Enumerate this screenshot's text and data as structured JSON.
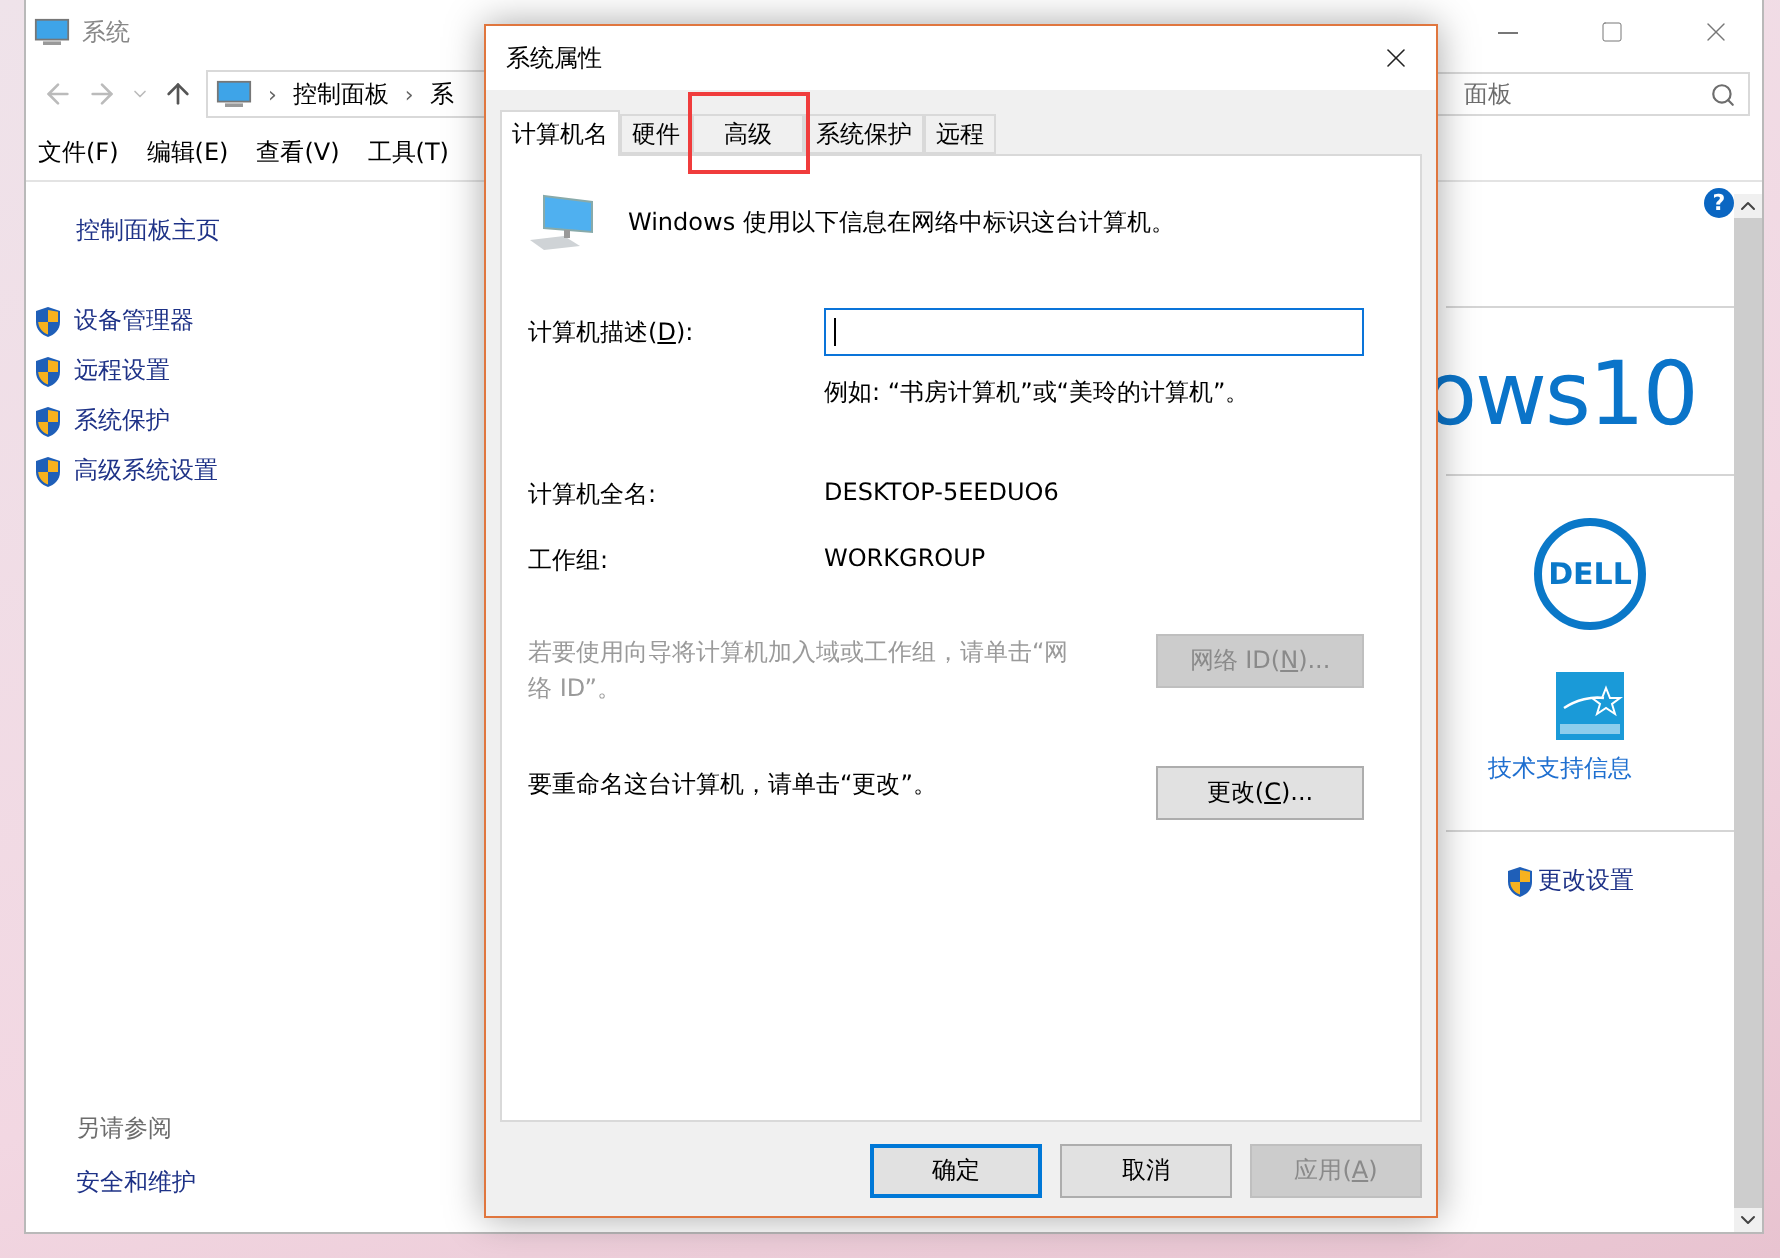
{
  "window": {
    "title": "系统",
    "breadcrumbs": [
      "控制面板",
      "系"
    ],
    "separator": "›",
    "search": {
      "value": "面板"
    },
    "help": "?",
    "menu": [
      "文件(F)",
      "编辑(E)",
      "查看(V)",
      "工具(T)"
    ],
    "sidebar": {
      "home": "控制面板主页",
      "items": [
        {
          "label": "设备管理器"
        },
        {
          "label": "远程设置"
        },
        {
          "label": "系统保护"
        },
        {
          "label": "高级系统设置"
        }
      ],
      "see_also": "另请参阅",
      "see_also_items": [
        "安全和维护"
      ]
    },
    "edition_text": "ows10",
    "oem_logo": "DELL",
    "support_link": "技术支持信息",
    "change_settings": "更改设置"
  },
  "dialog": {
    "title": "系统属性",
    "tabs": [
      {
        "label": "计算机名",
        "selected": true,
        "highlighted": false
      },
      {
        "label": "硬件",
        "selected": false,
        "highlighted": false
      },
      {
        "label": "高级",
        "selected": false,
        "highlighted": true
      },
      {
        "label": "系统保护",
        "selected": false,
        "highlighted": false
      },
      {
        "label": "远程",
        "selected": false,
        "highlighted": false
      }
    ],
    "intro": "Windows 使用以下信息在网络中标识这台计算机。",
    "description": {
      "label_before": "计算机描述(",
      "access_key": "D",
      "label_after": "):",
      "hint": "例如: “书房计算机”或“美玲的计算机”。"
    },
    "info": [
      {
        "label": "计算机全名:",
        "value": "DESKTOP-5EEDUO6"
      },
      {
        "label": "工作组:",
        "value": "WORKGROUP"
      }
    ],
    "actions": [
      {
        "text": "若要使用向导将计算机加入域或工作组，请单击“网络 ID”。",
        "disabled": true,
        "button": {
          "label_before": "网络 ID(",
          "access_key": "N",
          "label_after": ")...",
          "disabled": true
        }
      },
      {
        "text": "要重命名这台计算机，请单击“更改”。",
        "disabled": false,
        "button": {
          "label_before": "更改(",
          "access_key": "C",
          "label_after": ")...",
          "disabled": false
        }
      }
    ],
    "buttons": [
      {
        "label": "确定",
        "default": true,
        "disabled": false
      },
      {
        "label": "取消",
        "default": false,
        "disabled": false
      },
      {
        "label_before": "应用(",
        "access_key": "A",
        "label_after": ")",
        "default": false,
        "disabled": true
      }
    ]
  }
}
